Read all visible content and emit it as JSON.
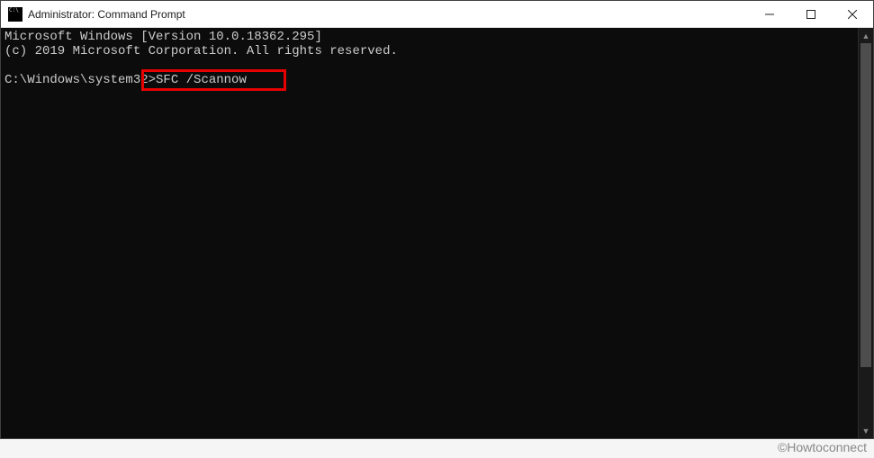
{
  "titlebar": {
    "icon_name": "cmd-icon",
    "title": "Administrator: Command Prompt",
    "minimize_label": "—",
    "maximize_label": "☐",
    "close_label": "✕"
  },
  "terminal": {
    "line1": "Microsoft Windows [Version 10.0.18362.295]",
    "line2": "(c) 2019 Microsoft Corporation. All rights reserved.",
    "prompt_path": "C:\\Windows\\system32>",
    "typed_command": "SFC /Scannow"
  },
  "scrollbar": {
    "up_glyph": "▲",
    "down_glyph": "▼"
  },
  "watermark": "©Howtoconnect"
}
